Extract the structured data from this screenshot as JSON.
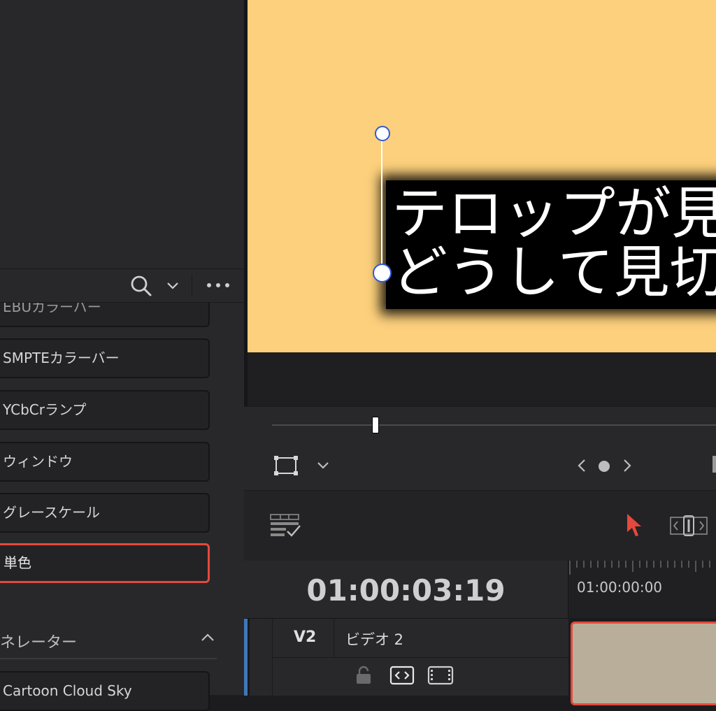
{
  "media_pool": {
    "items": [
      {
        "label": "EBUカラーバー"
      },
      {
        "label": "SMPTEカラーバー"
      },
      {
        "label": "YCbCrランプ"
      },
      {
        "label": "ウィンドウ"
      },
      {
        "label": "グレースケール"
      },
      {
        "label": "単色",
        "selected": true
      }
    ],
    "section_header": "ネレーター",
    "section_item": "Cartoon Cloud Sky",
    "toolbar_icons": [
      "search-icon",
      "chevron-down-icon",
      "more-icon"
    ]
  },
  "viewer": {
    "background_color": "#fcd07c",
    "caption_lines": [
      "テロップが見",
      "どうして見切"
    ]
  },
  "viewer_controls": {
    "icons": [
      "transform-icon",
      "chevron-down-icon",
      "prev-keyframe-icon",
      "keyframe-icon",
      "next-keyframe-icon"
    ]
  },
  "edit_toolbar": {
    "icons": [
      "timeline-options-icon",
      "selection-arrow-icon",
      "trim-edit-icon"
    ]
  },
  "timeline": {
    "timecode": "01:00:03:19",
    "ruler_start": "01:00:00:00",
    "tracks": [
      {
        "id": "V2",
        "name": "ビデオ 2",
        "icons": [
          "lock-icon",
          "auto-select-icon",
          "track-enable-icon"
        ]
      }
    ]
  },
  "colors": {
    "selection_red": "#e5493d",
    "handle_blue": "#2d5bd8",
    "track_accent_blue": "#3f77b8"
  }
}
